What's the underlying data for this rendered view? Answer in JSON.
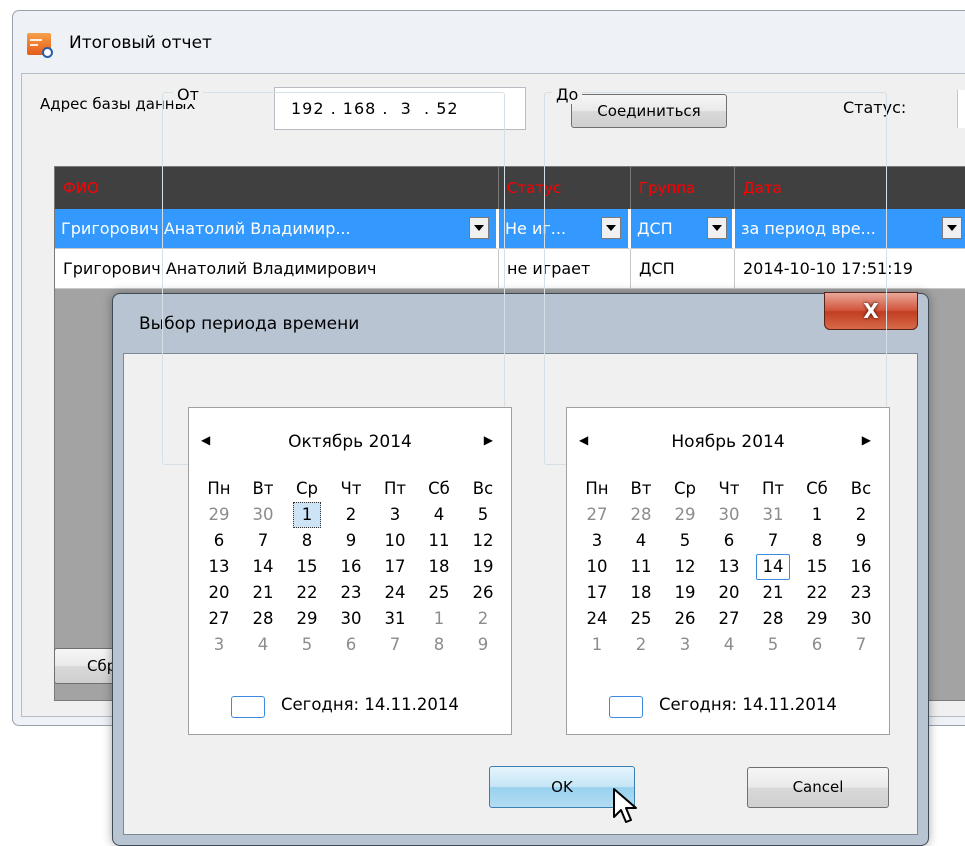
{
  "window": {
    "title": "Итоговый отчет"
  },
  "connection": {
    "db_label": "Адрес базы данных",
    "ip_value": "192 . 168 .  3  . 52",
    "connect_label": "Соединиться",
    "status_label": "Статус:"
  },
  "grid": {
    "headers": [
      "ФИО",
      "Статус",
      "Группа",
      "Дата"
    ],
    "selected_row": {
      "fio": "Григорович Анатолий Владимир...",
      "status": "Не иг...",
      "group": "ДСП",
      "date": "за период вре..."
    },
    "row": {
      "fio": "Григорович Анатолий Владимирович",
      "status": "не играет",
      "group": "ДСП",
      "date": "2014-10-10 17:51:19"
    }
  },
  "reset_label": "Сбр",
  "dialog": {
    "title": "Выбор периода времени",
    "close_label": "X",
    "from_label": "От",
    "to_label": "До",
    "ok_label": "OK",
    "cancel_label": "Cancel",
    "weekdays": [
      "Пн",
      "Вт",
      "Ср",
      "Чт",
      "Пт",
      "Сб",
      "Вс"
    ],
    "today_text": "Сегодня: 14.11.2014",
    "from_calendar": {
      "month": "Октябрь 2014",
      "weeks": [
        [
          "29",
          "30",
          "1",
          "2",
          "3",
          "4",
          "5"
        ],
        [
          "6",
          "7",
          "8",
          "9",
          "10",
          "11",
          "12"
        ],
        [
          "13",
          "14",
          "15",
          "16",
          "17",
          "18",
          "19"
        ],
        [
          "20",
          "21",
          "22",
          "23",
          "24",
          "25",
          "26"
        ],
        [
          "27",
          "28",
          "29",
          "30",
          "31",
          "1",
          "2"
        ],
        [
          "3",
          "4",
          "5",
          "6",
          "7",
          "8",
          "9"
        ]
      ]
    },
    "to_calendar": {
      "month": "Ноябрь 2014",
      "weeks": [
        [
          "27",
          "28",
          "29",
          "30",
          "31",
          "1",
          "2"
        ],
        [
          "3",
          "4",
          "5",
          "6",
          "7",
          "8",
          "9"
        ],
        [
          "10",
          "11",
          "12",
          "13",
          "14",
          "15",
          "16"
        ],
        [
          "17",
          "18",
          "19",
          "20",
          "21",
          "22",
          "23"
        ],
        [
          "24",
          "25",
          "26",
          "27",
          "28",
          "29",
          "30"
        ],
        [
          "1",
          "2",
          "3",
          "4",
          "5",
          "6",
          "7"
        ]
      ]
    }
  },
  "colors": {
    "header_text": "#ff0000",
    "header_bg": "#404040",
    "selection": "#3399ff"
  }
}
